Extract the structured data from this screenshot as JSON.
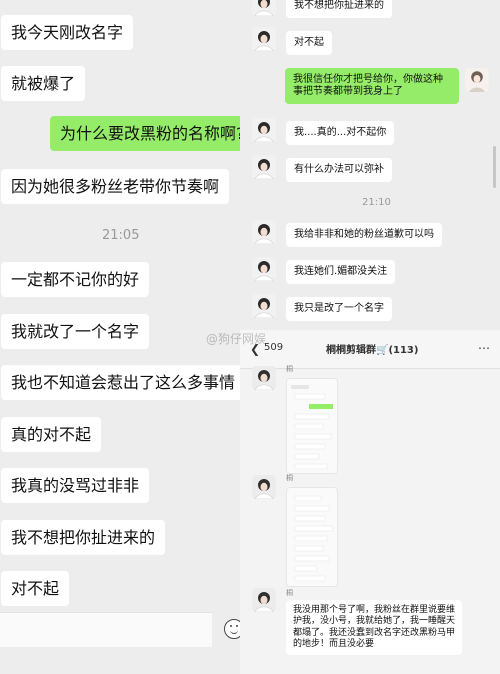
{
  "left_chat": {
    "messages": [
      "我今天刚改名字",
      "就被爆了",
      "为什么要改黑粉的名称啊?",
      "因为她很多粉丝老带你节奏啊",
      "一定都不记你的好",
      "我就改了一个名字",
      "我也不知道会惹出了这么多事情",
      "真的对不起",
      "我真的没骂过非非",
      "我不想把你扯进来的",
      "对不起"
    ],
    "timestamp": "21:05"
  },
  "right_chat": {
    "messages": [
      "我不想把你扯进来的",
      "对不起",
      "我很信任你才把号给你，你做这种事把节奏都带到我身上了",
      "我....真的...对不起你",
      "有什么办法可以弥补",
      "我给非非和她的粉丝道歉可以吗",
      "我连她们.媚都没关注",
      "我只是改了一个名字"
    ],
    "timestamp": "21:10"
  },
  "group_chat": {
    "back_count": "509",
    "title": "桐桐剪辑群🛒(113)",
    "sender": "桐",
    "last_message": "我没用那个号了啊，我粉丝在群里说要维护我，没小号，我就给她了，我一睡醒天都塌了。我还没蠢到改名字还改黑粉马甲的地步！而且没必要"
  },
  "watermark": "@狗仔网娱",
  "icons": {
    "emoji": "emoji-icon",
    "back": "chevron-left-icon",
    "more": "more-icon",
    "cart": "cart-icon"
  },
  "colors": {
    "bubble_green": "#95ec69",
    "bubble_white": "#ffffff",
    "background": "#ededed"
  }
}
